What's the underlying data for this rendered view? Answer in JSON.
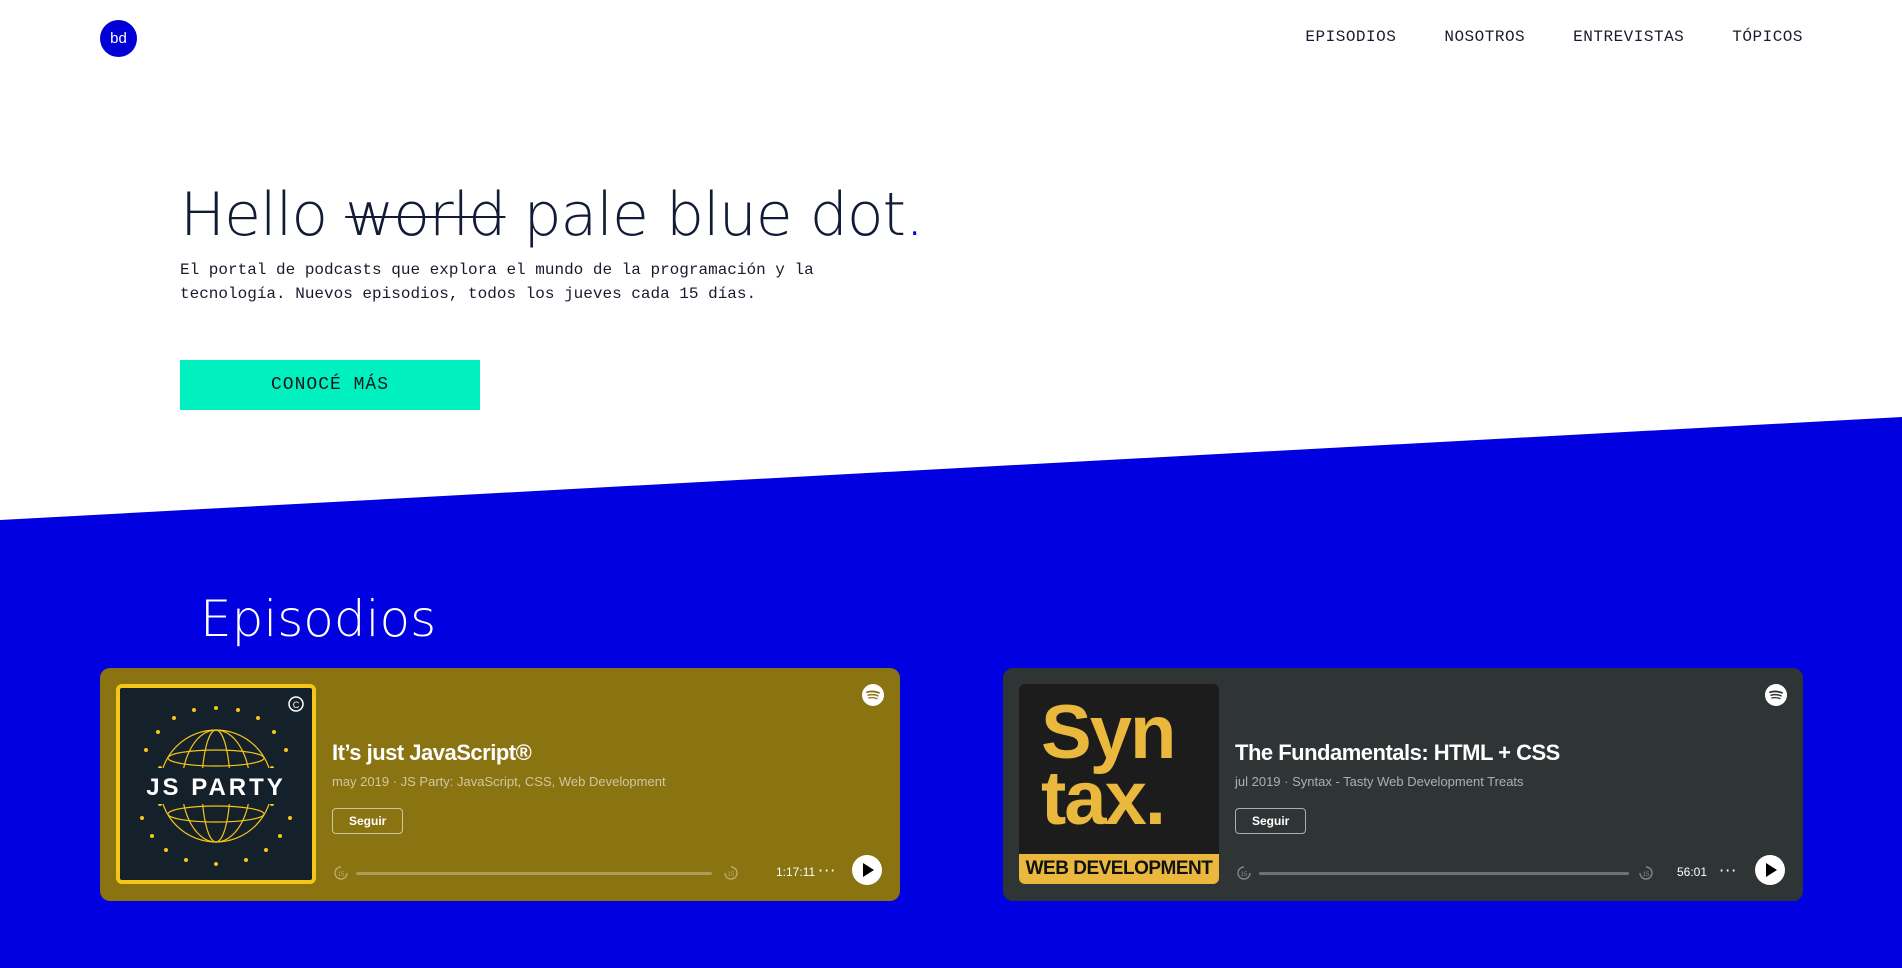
{
  "header": {
    "logo": "bd",
    "nav": [
      "EPISODIOS",
      "NOSOTROS",
      "ENTREVISTAS",
      "TÓPICOS"
    ]
  },
  "hero": {
    "title_start": "Hello",
    "title_struck": "world",
    "title_end": "pale blue dot",
    "title_dot": ".",
    "subtitle": "El portal de podcasts que explora el mundo de la programación y la tecnología. Nuevos episodios, todos los jueves cada 15 días.",
    "cta": "CONOCÉ MÁS"
  },
  "colors": {
    "accent_blue": "#0000e6",
    "cta_teal": "#00f0c0",
    "card1_bg": "#8a7311",
    "card2_bg": "#2f3535"
  },
  "episodes": {
    "title": "Episodios",
    "items": [
      {
        "cover_label": "JS PARTY",
        "title": "It’s just JavaScript®",
        "meta": "may 2019 · JS Party: JavaScript, CSS, Web Development",
        "follow": "Seguir",
        "duration": "1:17:11",
        "more": "···",
        "skip_back": "15",
        "skip_forward": "15",
        "progress": 0
      },
      {
        "cover_word1": "Syn",
        "cover_word2": "tax.",
        "cover_banner": "WEB DEVELOPMENT",
        "title": "The Fundamentals: HTML + CSS",
        "meta": "jul 2019 · Syntax - Tasty Web Development Treats",
        "follow": "Seguir",
        "duration": "56:01",
        "more": "···",
        "skip_back": "15",
        "skip_forward": "15",
        "progress": 0
      }
    ]
  }
}
